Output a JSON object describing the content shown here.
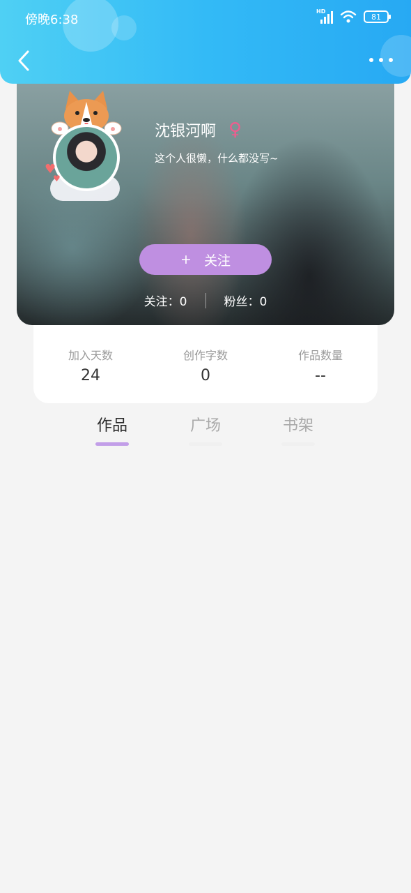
{
  "status_bar": {
    "time": "傍晚6:38",
    "hd_label": "HD",
    "battery": "81",
    "icons": [
      "signal-icon",
      "wifi-icon",
      "battery-icon"
    ]
  },
  "header": {
    "back_icon": "chevron-left-icon",
    "more_icon": "more-dots-icon",
    "gradient_colors": [
      "#4fd0f4",
      "#27a9f3"
    ]
  },
  "profile": {
    "nickname": "沈银河啊",
    "gender_symbol": "♀",
    "signature": "这个人很懒，什么都没写~",
    "follow_button": {
      "icon": "+",
      "label": "关注"
    },
    "following": "关注：0",
    "followers": "粉丝：0",
    "accent_color": "#bf8fe1",
    "gender_color": "#ef5d8e"
  },
  "stats": [
    {
      "label": "加入天数",
      "value": "24"
    },
    {
      "label": "创作字数",
      "value": "0"
    },
    {
      "label": "作品数量",
      "value": "--"
    }
  ],
  "tabs": [
    {
      "label": "作品",
      "active": true
    },
    {
      "label": "广场",
      "active": false
    },
    {
      "label": "书架",
      "active": false
    }
  ]
}
